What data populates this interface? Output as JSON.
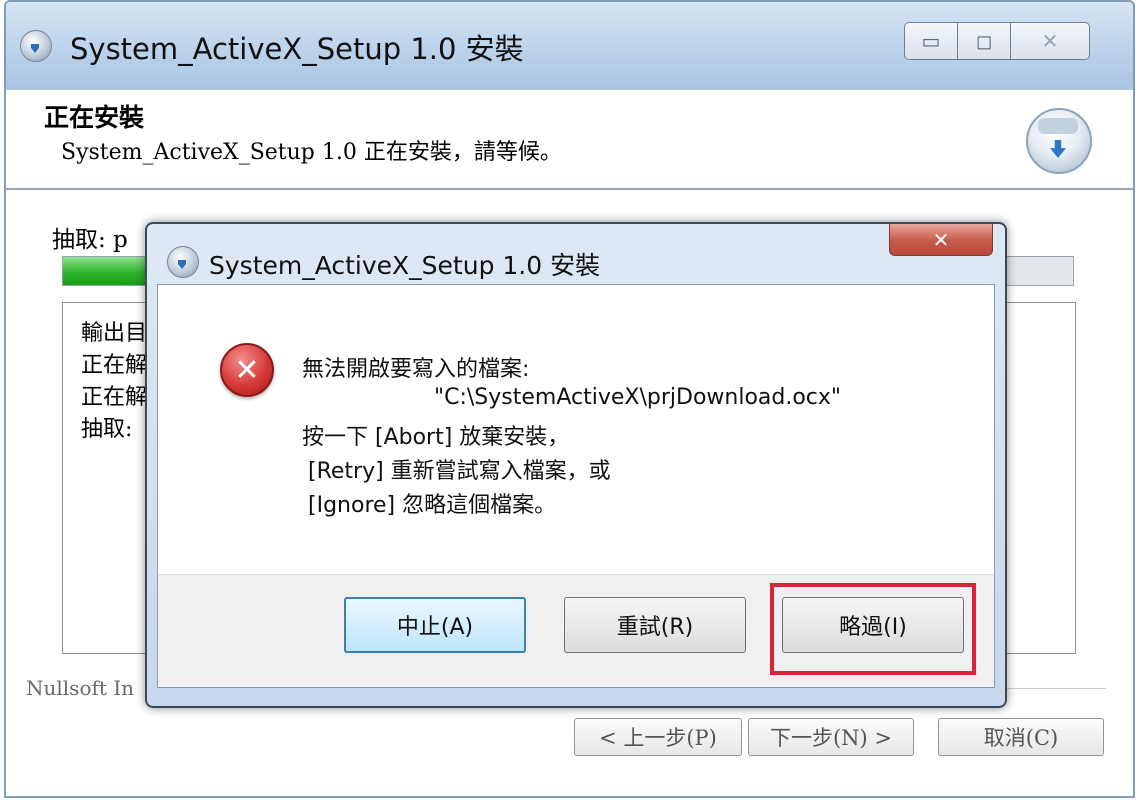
{
  "main_window": {
    "title": "System_ActiveX_Setup 1.0 安裝",
    "header_title": "正在安裝",
    "header_subtitle": "System_ActiveX_Setup 1.0 正在安裝，請等候。",
    "extract_label": "抽取: p",
    "progress_fraction": 0.095,
    "log_lines": [
      "輸出目",
      "正在解",
      "正在解",
      "抽取:"
    ],
    "brand": "Nullsoft In",
    "buttons": {
      "back": "< 上一步(P)",
      "next": "下一步(N) >",
      "cancel": "取消(C)"
    },
    "window_controls": {
      "minimize": "▭",
      "maximize": "◻",
      "close": "✕"
    }
  },
  "dialog": {
    "title": "System_ActiveX_Setup 1.0 安裝",
    "close_label": "✕",
    "icon": "error-icon",
    "message": {
      "line1": "無法開啟要寫入的檔案:",
      "path": "\"C:\\SystemActiveX\\prjDownload.ocx\"",
      "line3": "按一下 [Abort] 放棄安裝，",
      "line4": "[Retry] 重新嘗試寫入檔案，或",
      "line5": "[Ignore] 忽略這個檔案。"
    },
    "buttons": {
      "abort": "中止(A)",
      "retry": "重試(R)",
      "ignore": "略過(I)"
    }
  },
  "colors": {
    "highlight": "#d9233b",
    "progress": "#2fb52f",
    "error": "#d63a3a"
  }
}
